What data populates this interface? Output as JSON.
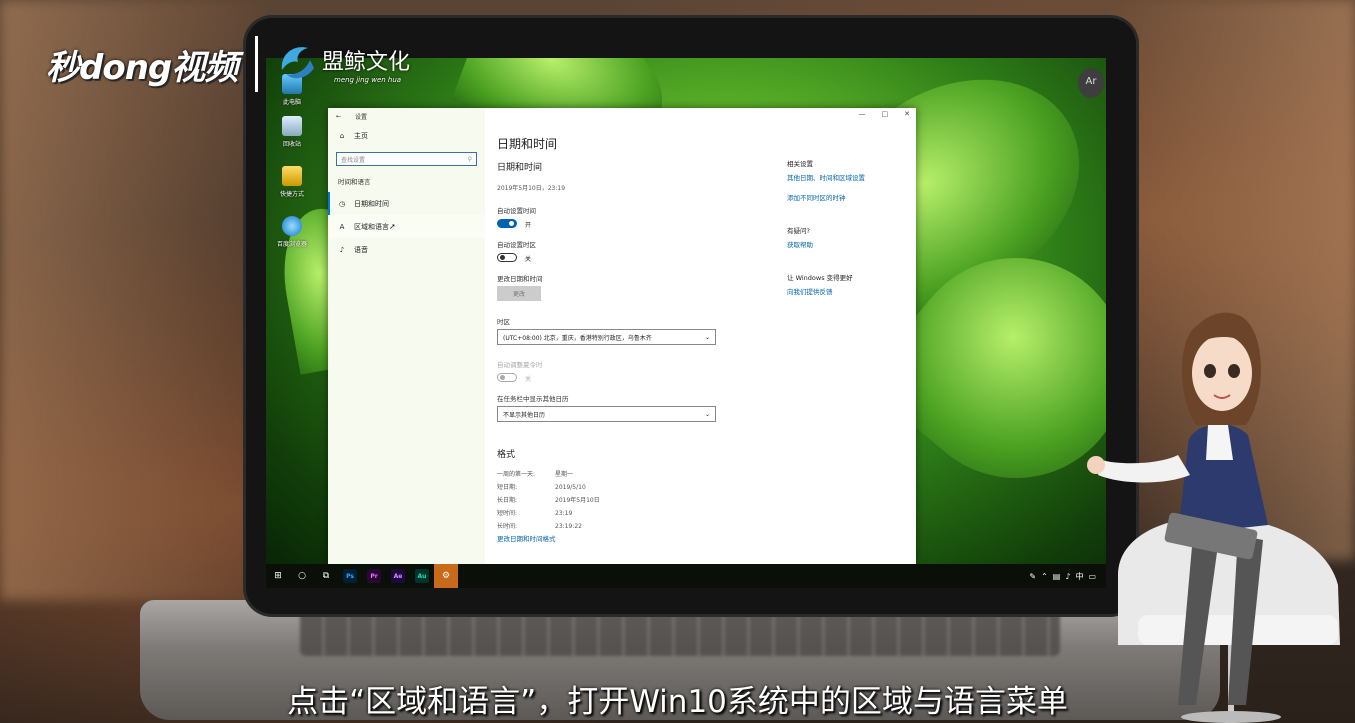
{
  "branding": {
    "logo_left": "秒dong视频",
    "logo_right": "盟鲸文化",
    "logo_right_sub": "meng jing wen hua"
  },
  "subtitle": "点击“区域和语言”，打开Win10系统中的区域与语言菜单",
  "desktop": {
    "icons": [
      {
        "label": "此电脑",
        "icon": "computer-icon"
      },
      {
        "label": "回收站",
        "icon": "recycle-bin-icon"
      },
      {
        "label": "快捷方式",
        "icon": "folder-shortcut-icon"
      },
      {
        "label": "百度浏览器",
        "icon": "baidu-browser-icon"
      }
    ],
    "user_badge": "Ar\n23"
  },
  "settings": {
    "window_title": "设置",
    "back_glyph": "←",
    "window_buttons": [
      "—",
      "□",
      "✕"
    ],
    "sidebar": {
      "home": "主页",
      "search_placeholder": "查找设置",
      "group": "时间和语言",
      "items": [
        {
          "label": "日期和时间",
          "icon": "calendar-clock-icon",
          "selected": true
        },
        {
          "label": "区域和语言",
          "icon": "region-language-icon",
          "hovered": true
        },
        {
          "label": "语音",
          "icon": "microphone-icon"
        }
      ]
    },
    "main": {
      "page_title": "日期和时间",
      "section_title": "日期和时间",
      "current_datetime": "2019年5月10日，23:19",
      "auto_time_label": "自动设置时间",
      "auto_time_state": "开",
      "auto_zone_label": "自动设置时区",
      "auto_zone_state": "关",
      "change_label": "更改日期和时间",
      "change_button": "更改",
      "timezone_label": "时区",
      "timezone_value": "(UTC+08:00) 北京，重庆，香港特别行政区，乌鲁木齐",
      "dst_label": "自动调整夏令时",
      "dst_state": "关",
      "taskbar_cal_label": "在任务栏中显示其他日历",
      "taskbar_cal_value": "不显示其他日历",
      "format_title": "格式",
      "formats": [
        {
          "key": "一周的第一天:",
          "value": "星期一"
        },
        {
          "key": "短日期:",
          "value": "2019/5/10"
        },
        {
          "key": "长日期:",
          "value": "2019年5月10日"
        },
        {
          "key": "短时间:",
          "value": "23:19"
        },
        {
          "key": "长时间:",
          "value": "23:19:22"
        }
      ],
      "format_link": "更改日期和时间格式"
    },
    "related": {
      "title": "相关设置",
      "link1": "其他日期、时间和区域设置",
      "link2": "添加不同时区的时钟",
      "help_title": "有疑问?",
      "help_link": "获取帮助",
      "feedback_title": "让 Windows 变得更好",
      "feedback_link": "向我们提供反馈"
    }
  },
  "taskbar": {
    "apps": [
      {
        "label": "Ps",
        "color": "#31a8ff",
        "bg": "#001e36"
      },
      {
        "label": "Pr",
        "color": "#ea77ff",
        "bg": "#2a0634"
      },
      {
        "label": "Ae",
        "color": "#d291ff",
        "bg": "#1f0740"
      },
      {
        "label": "Au",
        "color": "#00e4bb",
        "bg": "#00332a"
      }
    ]
  },
  "colors": {
    "accent": "#0063b1",
    "link": "#0063b1",
    "taskbar": "#0a0f08"
  }
}
